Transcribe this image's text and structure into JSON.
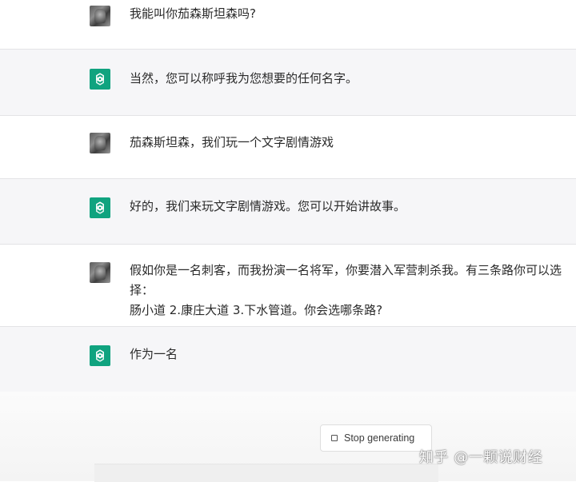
{
  "conversation": {
    "messages": [
      {
        "role": "user",
        "text": "我能叫你茄森斯坦森吗?"
      },
      {
        "role": "assistant",
        "text": "当然，您可以称呼我为您想要的任何名字。"
      },
      {
        "role": "user",
        "text": "茄森斯坦森，我们玩一个文字剧情游戏"
      },
      {
        "role": "assistant",
        "text": "好的，我们来玩文字剧情游戏。您可以开始讲故事。"
      },
      {
        "role": "user",
        "text": "假如你是一名刺客，而我扮演一名将军，你要潜入军营刺杀我。有三条路你可以选择：\n肠小道 2.康庄大道 3.下水管道。你会选哪条路?"
      },
      {
        "role": "assistant",
        "text": "作为一名"
      }
    ]
  },
  "controls": {
    "stop_label": "Stop generating"
  },
  "watermark": {
    "text": "知乎 @一颗说财经"
  },
  "colors": {
    "bot_avatar": "#10a37f",
    "bot_row_bg": "#f6f6f8",
    "user_row_bg": "#ffffff"
  },
  "icons": {
    "user_avatar": "user-photo-avatar",
    "bot_avatar": "openai-logo-icon",
    "stop": "stop-square-icon"
  }
}
